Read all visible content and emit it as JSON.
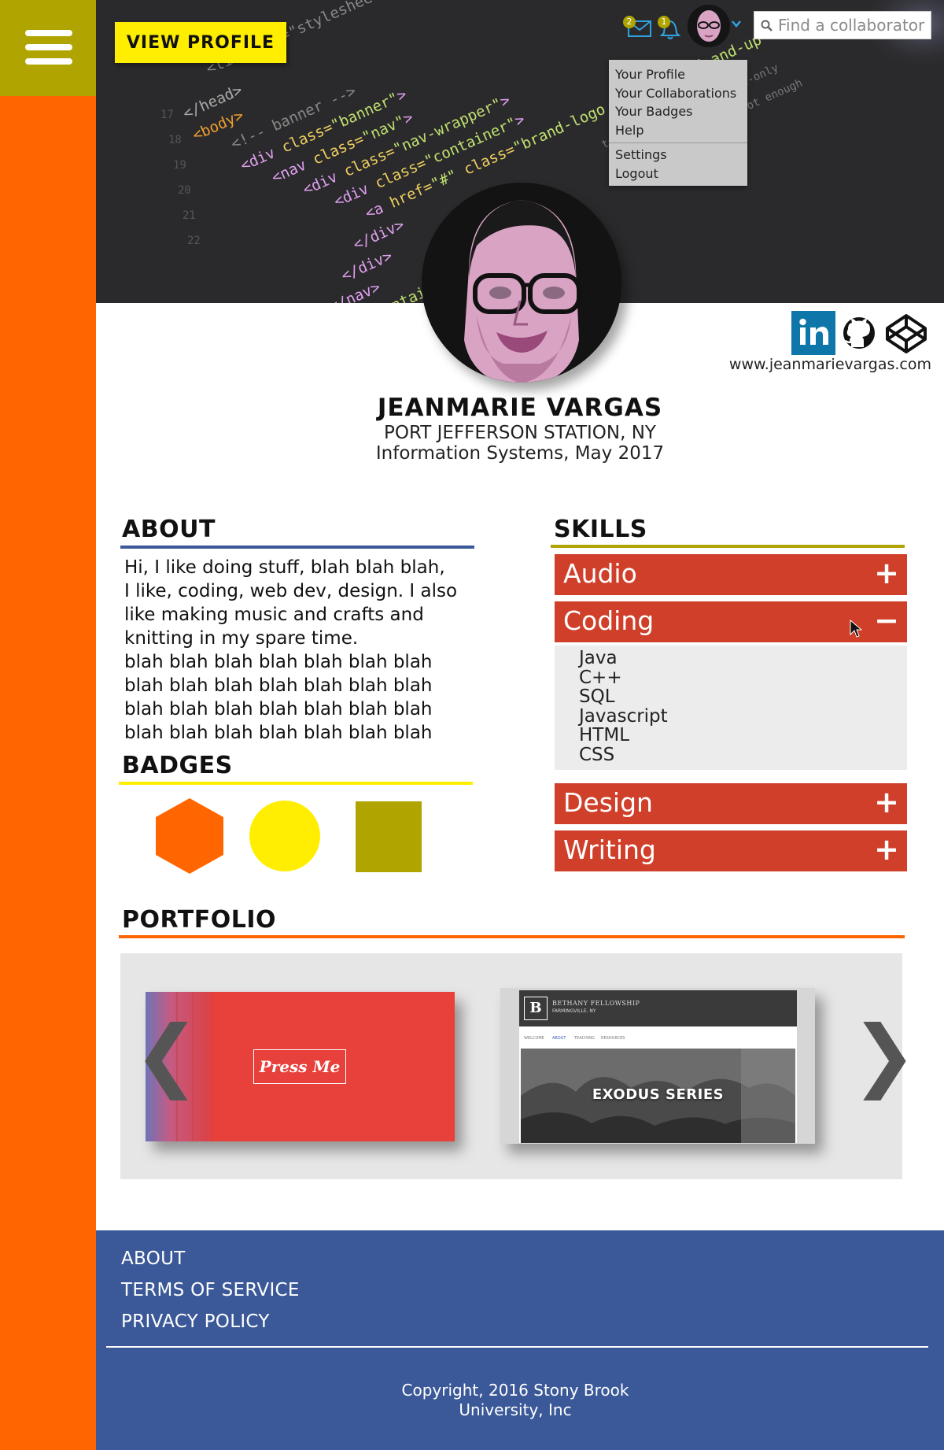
{
  "nav": {
    "view_profile": "VIEW PROFILE",
    "mail_count": "2",
    "notification_count": "1",
    "search_placeholder": "Find a collaborator"
  },
  "dropdown": {
    "items_group1": [
      "Your Profile",
      "Your Collaborations",
      "Your Badges",
      "Help"
    ],
    "items_group2": [
      "Settings",
      "Logout"
    ]
  },
  "profile": {
    "name": "JEANMARIE VARGAS",
    "location": "PORT JEFFERSON STATION, NY",
    "major": "Information Systems, May 2017",
    "website": "www.jeanmarievargas.com",
    "social_icons": [
      "linkedin-icon",
      "github-icon",
      "codepen-icon"
    ]
  },
  "about": {
    "title": "ABOUT",
    "lines": [
      "Hi, I like doing stuff, blah blah blah,",
      "I like, coding, web dev, design. I also",
      "like making music and crafts and",
      "knitting in my spare time.",
      "blah blah blah blah blah blah blah",
      "blah blah blah blah blah blah blah",
      "blah blah blah blah blah blah blah",
      "blah blah blah blah blah blah blah"
    ]
  },
  "badges": {
    "title": "BADGES",
    "items": [
      {
        "shape": "hexagon",
        "color": "#ff6600"
      },
      {
        "shape": "circle",
        "color": "#ffee00"
      },
      {
        "shape": "square",
        "color": "#b0a500"
      }
    ]
  },
  "skills": {
    "title": "SKILLS",
    "categories": [
      {
        "label": "Audio",
        "toggle": "+",
        "expanded": false
      },
      {
        "label": "Coding",
        "toggle": "−",
        "expanded": true
      },
      {
        "label": "Design",
        "toggle": "+",
        "expanded": false
      },
      {
        "label": "Writing",
        "toggle": "+",
        "expanded": false
      }
    ],
    "coding_items": [
      "Java",
      "C++",
      "SQL",
      "Javascript",
      "HTML",
      "CSS"
    ]
  },
  "portfolio": {
    "title": "PORTFOLIO",
    "prev": "❮",
    "next": "❯",
    "card1_button": "Press Me",
    "card2": {
      "logo": "B",
      "site_name": "BETHANY FELLOWSHIP",
      "site_location": "FARMINGVILLE, NY",
      "nav": [
        "WELCOME",
        "ABOUT",
        "TEACHING",
        "RESOURCES"
      ],
      "banner": "EXODUS SERIES"
    }
  },
  "footer": {
    "links": [
      "ABOUT",
      "TERMS OF SERVICE",
      "PRIVACY POLICY"
    ],
    "copyright_line1": "Copyright, 2016 Stony Brook",
    "copyright_line2": "University, Inc"
  },
  "colors": {
    "sidebar": "#ff6600",
    "menu_block": "#b0a500",
    "accent_yellow": "#ffee00",
    "skill_red": "#cf3f2a",
    "footer_blue": "#3b5998",
    "about_rule": "#3b5998",
    "badge_rule": "#ffee00",
    "skills_rule": "#b0a500",
    "portfolio_rule": "#ff6600"
  }
}
